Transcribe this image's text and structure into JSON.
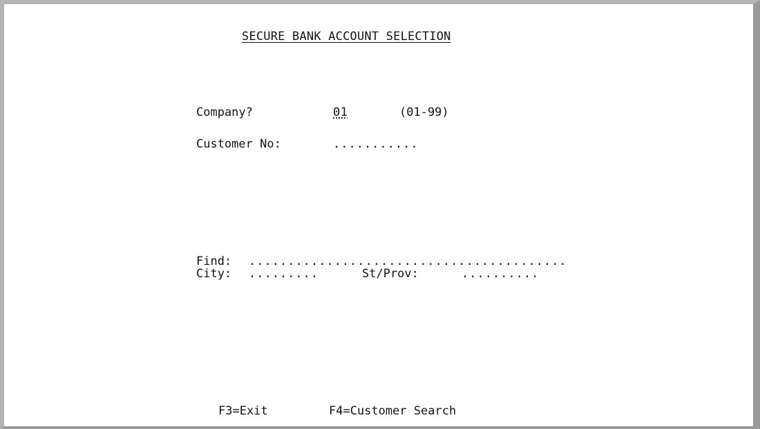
{
  "screen": {
    "title": "SECURE BANK ACCOUNT SELECTION"
  },
  "form": {
    "company_label": "Company?",
    "company_value": "01",
    "company_range": "(01-99)",
    "customer_label": "Customer No:",
    "customer_value": "...........",
    "find_label": "Find:",
    "find_value": ".........................................",
    "city_label": "City:",
    "city_value": ".........",
    "st_prov_label": "St/Prov:",
    "st_prov_value": ".........."
  },
  "function_keys": {
    "exit": "F3=Exit",
    "customer_search": "F4=Customer Search"
  }
}
